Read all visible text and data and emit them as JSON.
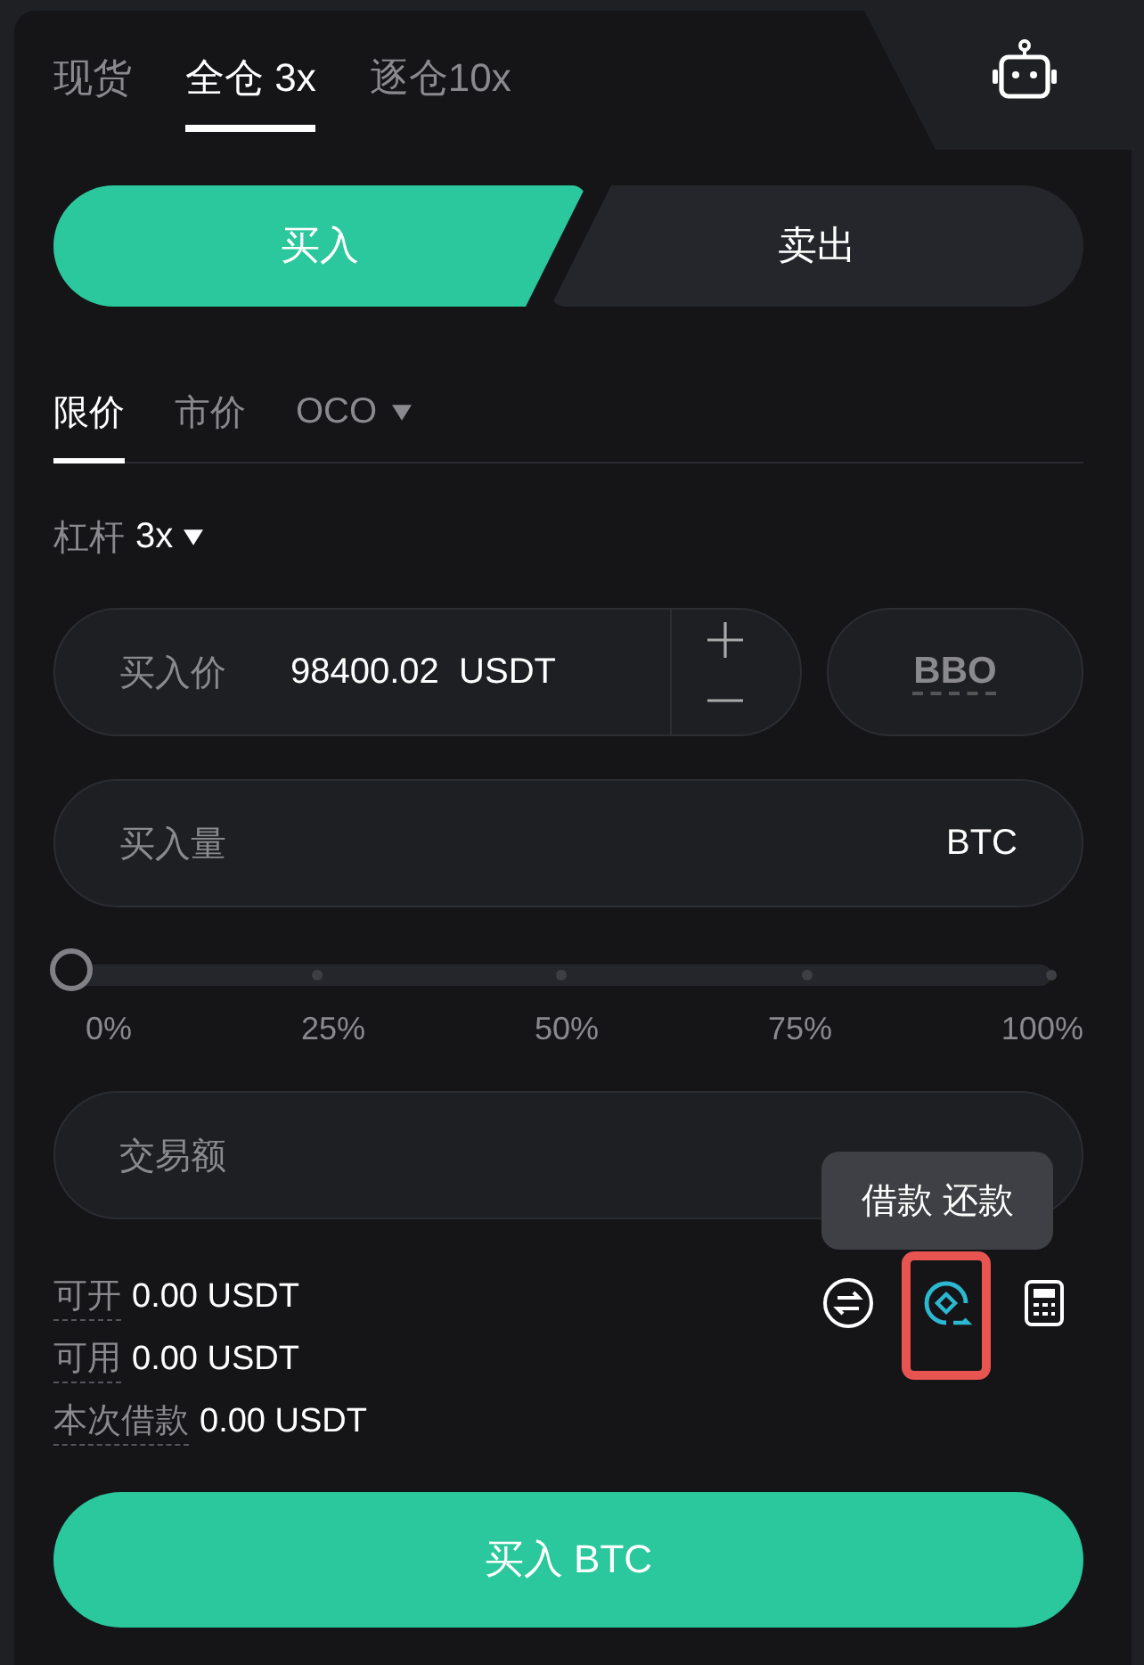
{
  "account_tabs": [
    {
      "label": "现货",
      "selected": false
    },
    {
      "label": "全仓 3x",
      "selected": true
    },
    {
      "label": "逐仓10x",
      "selected": false
    }
  ],
  "side_tabs": [
    {
      "label": "买入",
      "selected": true
    },
    {
      "label": "卖出",
      "selected": false
    }
  ],
  "order_types": [
    {
      "label": "限价",
      "selected": true,
      "dropdown": false
    },
    {
      "label": "市价",
      "selected": false,
      "dropdown": false
    },
    {
      "label": "OCO",
      "selected": false,
      "dropdown": true
    }
  ],
  "leverage": {
    "label": "杠杆",
    "value": "3x"
  },
  "price_field": {
    "placeholder": "买入价",
    "value": "98400.02",
    "unit": "USDT"
  },
  "bbo_button": "BBO",
  "amount_field": {
    "placeholder": "买入量",
    "unit": "BTC"
  },
  "slider": {
    "level": 0,
    "marks": [
      "0%",
      "25%",
      "50%",
      "75%",
      "100%"
    ]
  },
  "total_field": {
    "placeholder": "交易额"
  },
  "tooltip": "借款 还款",
  "tools": [
    {
      "kind": "transfer",
      "highlighted": false
    },
    {
      "kind": "borrow",
      "highlighted": true
    },
    {
      "kind": "calculator",
      "highlighted": false
    }
  ],
  "info": [
    {
      "label": "可开",
      "value": "0.00 USDT"
    },
    {
      "label": "可用",
      "value": "0.00 USDT"
    },
    {
      "label": "本次借款",
      "value": "0.00 USDT"
    }
  ],
  "submit_button": "买入 BTC"
}
